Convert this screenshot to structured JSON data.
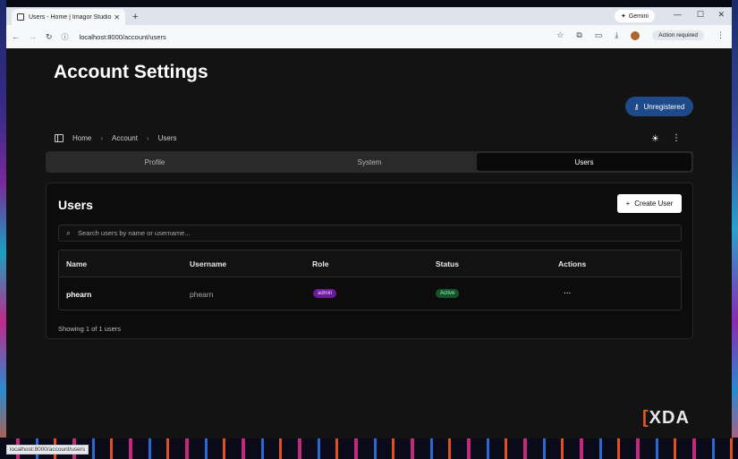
{
  "browser": {
    "tab_title": "Users - Home | Imagor Studio",
    "new_tab_icon": "plus-icon",
    "gemini_label": "Gemini",
    "url": "localhost:8000/account/users",
    "action_required": "Action required",
    "status_bar_url": "localhost:8000/account/users"
  },
  "header": {
    "title": "Account Settings",
    "unregistered_label": "Unregistered"
  },
  "breadcrumb": [
    "Home",
    "Account",
    "Users"
  ],
  "tabs": [
    {
      "label": "Profile",
      "active": false
    },
    {
      "label": "System",
      "active": false
    },
    {
      "label": "Users",
      "active": true
    }
  ],
  "users_card": {
    "title": "Users",
    "create_button": "Create User",
    "search_placeholder": "Search users by name or username...",
    "columns": [
      "Name",
      "Username",
      "Role",
      "Status",
      "Actions"
    ],
    "rows": [
      {
        "name": "phearn",
        "username": "phearn",
        "role": "admin",
        "status": "Active",
        "actions": "..."
      }
    ],
    "footer": "Showing 1 of 1 users"
  },
  "watermark": "XDA",
  "colors": {
    "unregistered_bg": "#1e4a8a",
    "role_badge": "#6a1a9a",
    "status_badge": "#14532d",
    "background": "#131313"
  }
}
